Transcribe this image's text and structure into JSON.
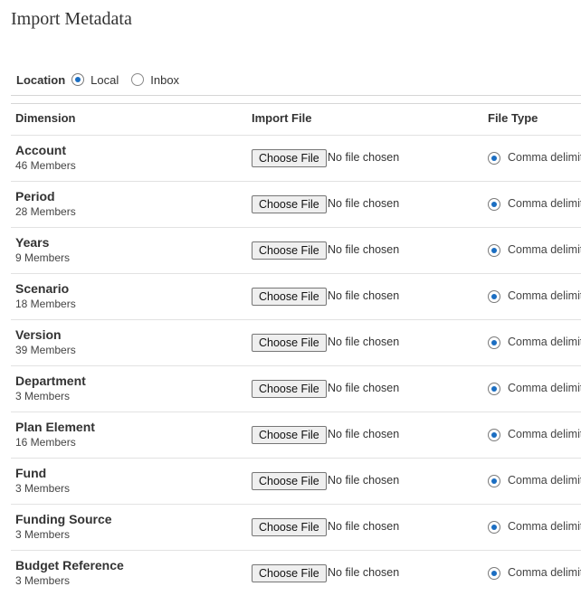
{
  "page": {
    "title": "Import Metadata"
  },
  "location": {
    "label": "Location",
    "options": [
      {
        "label": "Local",
        "selected": true
      },
      {
        "label": "Inbox",
        "selected": false
      }
    ]
  },
  "table": {
    "headers": {
      "dimension": "Dimension",
      "import_file": "Import File",
      "file_type": "File Type"
    },
    "choose_file_label": "Choose File",
    "no_file_text": "No file chosen",
    "file_type_label": "Comma delimit",
    "rows": [
      {
        "name": "Account",
        "members": "46 Members"
      },
      {
        "name": "Period",
        "members": "28 Members"
      },
      {
        "name": "Years",
        "members": "9 Members"
      },
      {
        "name": "Scenario",
        "members": "18 Members"
      },
      {
        "name": "Version",
        "members": "39 Members"
      },
      {
        "name": "Department",
        "members": "3 Members"
      },
      {
        "name": "Plan Element",
        "members": "16 Members"
      },
      {
        "name": "Fund",
        "members": "3 Members"
      },
      {
        "name": "Funding Source",
        "members": "3 Members"
      },
      {
        "name": "Budget Reference",
        "members": "3 Members"
      }
    ]
  },
  "colors": {
    "accent": "#1b6ec2",
    "divider": "#d6d6d6"
  }
}
